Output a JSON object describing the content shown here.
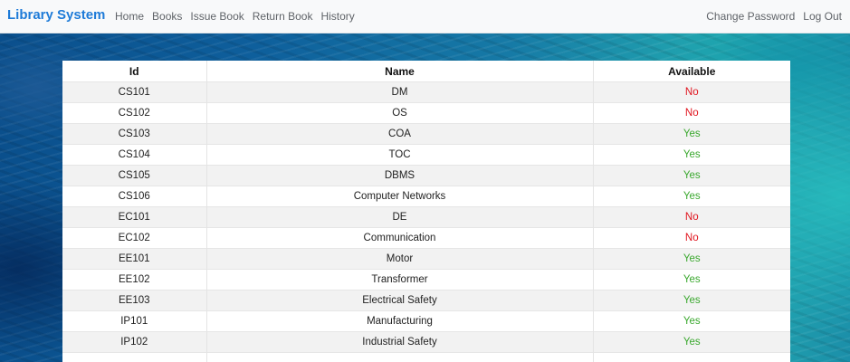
{
  "navbar": {
    "brand": "Library System",
    "left_links": [
      "Home",
      "Books",
      "Issue Book",
      "Return Book",
      "History"
    ],
    "right_links": [
      "Change Password",
      "Log Out"
    ]
  },
  "table": {
    "headers": [
      "Id",
      "Name",
      "Available"
    ],
    "rows": [
      {
        "id": "CS101",
        "name": "DM",
        "available": "No"
      },
      {
        "id": "CS102",
        "name": "OS",
        "available": "No"
      },
      {
        "id": "CS103",
        "name": "COA",
        "available": "Yes"
      },
      {
        "id": "CS104",
        "name": "TOC",
        "available": "Yes"
      },
      {
        "id": "CS105",
        "name": "DBMS",
        "available": "Yes"
      },
      {
        "id": "CS106",
        "name": "Computer Networks",
        "available": "Yes"
      },
      {
        "id": "EC101",
        "name": "DE",
        "available": "No"
      },
      {
        "id": "EC102",
        "name": "Communication",
        "available": "No"
      },
      {
        "id": "EE101",
        "name": "Motor",
        "available": "Yes"
      },
      {
        "id": "EE102",
        "name": "Transformer",
        "available": "Yes"
      },
      {
        "id": "EE103",
        "name": "Electrical Safety",
        "available": "Yes"
      },
      {
        "id": "IP101",
        "name": "Manufacturing",
        "available": "Yes"
      },
      {
        "id": "IP102",
        "name": "Industrial Safety",
        "available": "Yes"
      },
      {
        "id": "",
        "name": "",
        "available": ""
      }
    ]
  },
  "colors": {
    "brand": "#1e7bd8",
    "available_yes": "#3aa82e",
    "available_no": "#e0141e"
  }
}
